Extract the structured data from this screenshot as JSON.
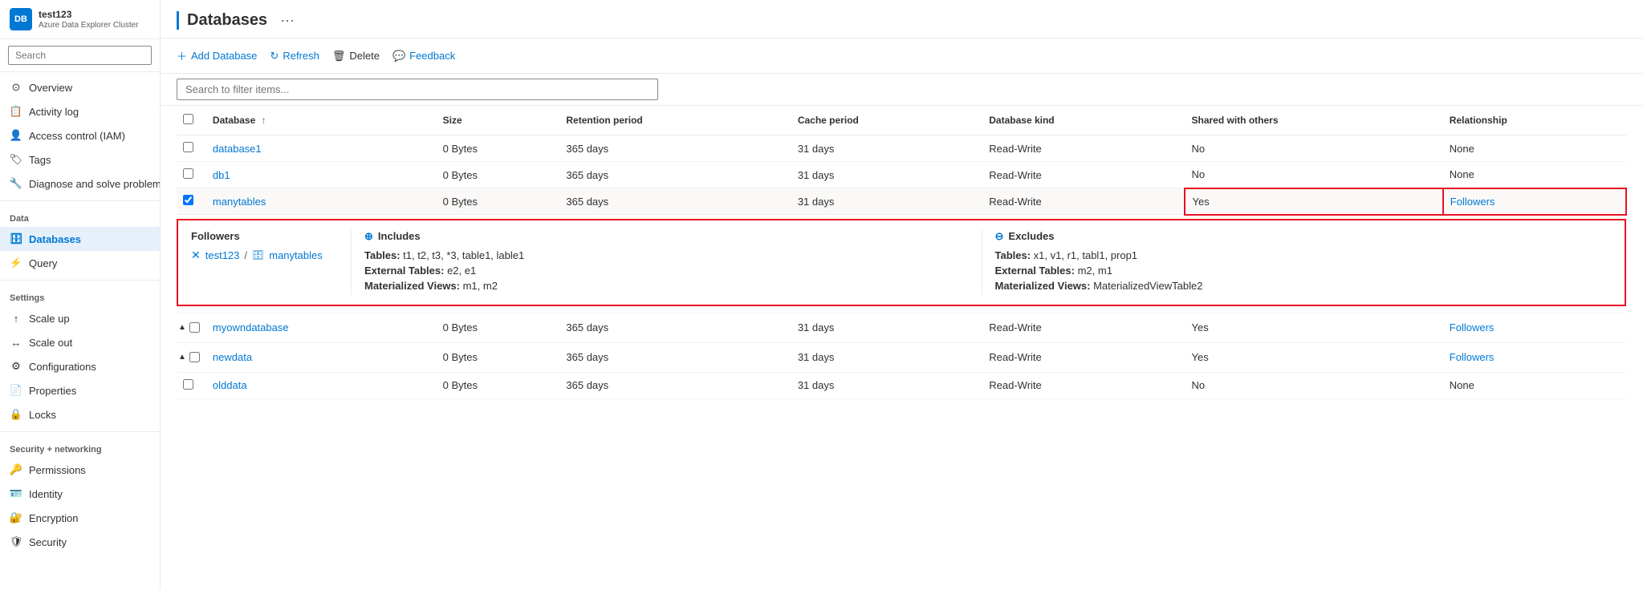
{
  "sidebar": {
    "logo_text": "DB",
    "cluster_name": "test123",
    "cluster_type": "Azure Data Explorer Cluster",
    "search_placeholder": "Search",
    "nav_items": [
      {
        "label": "Overview",
        "icon": "overview",
        "active": false,
        "section": null
      },
      {
        "label": "Activity log",
        "icon": "activity",
        "active": false,
        "section": null
      },
      {
        "label": "Access control (IAM)",
        "icon": "iam",
        "active": false,
        "section": null
      },
      {
        "label": "Tags",
        "icon": "tags",
        "active": false,
        "section": null
      },
      {
        "label": "Diagnose and solve problems",
        "icon": "diagnose",
        "active": false,
        "section": null
      }
    ],
    "data_section": "Data",
    "data_items": [
      {
        "label": "Databases",
        "icon": "databases",
        "active": true
      },
      {
        "label": "Query",
        "icon": "query",
        "active": false
      }
    ],
    "settings_section": "Settings",
    "settings_items": [
      {
        "label": "Scale up",
        "icon": "scaleup",
        "active": false
      },
      {
        "label": "Scale out",
        "icon": "scaleout",
        "active": false
      },
      {
        "label": "Configurations",
        "icon": "config",
        "active": false
      },
      {
        "label": "Properties",
        "icon": "properties",
        "active": false
      },
      {
        "label": "Locks",
        "icon": "locks",
        "active": false
      }
    ],
    "security_section": "Security + networking",
    "security_items": [
      {
        "label": "Permissions",
        "icon": "permissions",
        "active": false
      },
      {
        "label": "Identity",
        "icon": "identity",
        "active": false
      },
      {
        "label": "Encryption",
        "icon": "encryption",
        "active": false
      },
      {
        "label": "Security",
        "icon": "security",
        "active": false
      }
    ]
  },
  "page": {
    "title": "Databases",
    "toolbar": {
      "add_label": "Add Database",
      "refresh_label": "Refresh",
      "delete_label": "Delete",
      "feedback_label": "Feedback"
    },
    "search_placeholder": "Search to filter items...",
    "table": {
      "columns": [
        "Database ↑",
        "Size",
        "Retention period",
        "Cache period",
        "Database kind",
        "Shared with others",
        "Relationship"
      ],
      "rows": [
        {
          "id": "database1",
          "name": "database1",
          "size": "0 Bytes",
          "retention": "365 days",
          "cache": "31 days",
          "kind": "Read-Write",
          "shared": "No",
          "relationship": "None",
          "expanded": false,
          "has_expand": false
        },
        {
          "id": "db1",
          "name": "db1",
          "size": "0 Bytes",
          "retention": "365 days",
          "cache": "31 days",
          "kind": "Read-Write",
          "shared": "No",
          "relationship": "None",
          "expanded": false,
          "has_expand": false
        },
        {
          "id": "manytables",
          "name": "manytables",
          "size": "0 Bytes",
          "retention": "365 days",
          "cache": "31 days",
          "kind": "Read-Write",
          "shared": "Yes",
          "relationship": "Followers",
          "expanded": true,
          "has_expand": true,
          "followers": {
            "cluster": "test123",
            "database": "manytables",
            "includes": {
              "tables": "t1, t2, t3, *3, table1, lable1",
              "external_tables": "e2, e1",
              "materialized_views": "m1, m2"
            },
            "excludes": {
              "tables": "x1, v1, r1, tabl1, prop1",
              "external_tables": "m2, m1",
              "materialized_views": "MaterializedViewTable2"
            }
          }
        },
        {
          "id": "myowndatabase",
          "name": "myowndatabase",
          "size": "0 Bytes",
          "retention": "365 days",
          "cache": "31 days",
          "kind": "Read-Write",
          "shared": "Yes",
          "relationship": "Followers",
          "expanded": false,
          "has_expand": true,
          "chevron": "▲"
        },
        {
          "id": "newdata",
          "name": "newdata",
          "size": "0 Bytes",
          "retention": "365 days",
          "cache": "31 days",
          "kind": "Read-Write",
          "shared": "Yes",
          "relationship": "Followers",
          "expanded": false,
          "has_expand": true,
          "chevron": "▲"
        },
        {
          "id": "olddata",
          "name": "olddata",
          "size": "0 Bytes",
          "retention": "365 days",
          "cache": "31 days",
          "kind": "Read-Write",
          "shared": "No",
          "relationship": "None",
          "expanded": false,
          "has_expand": false
        }
      ]
    }
  }
}
